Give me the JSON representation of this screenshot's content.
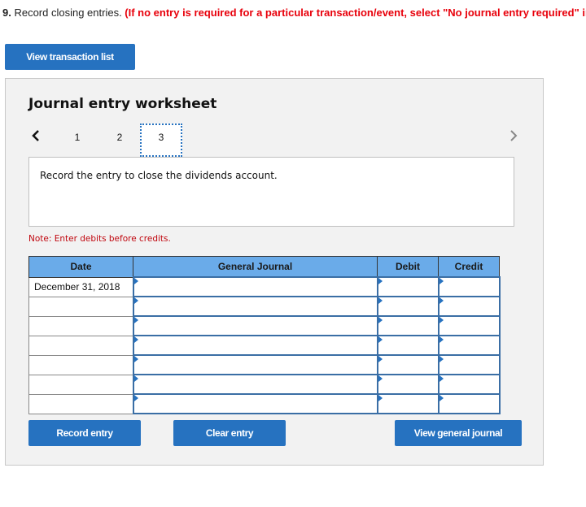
{
  "question": {
    "number": "9.",
    "text": " Record closing entries. ",
    "instruction": "(If no entry is required for a particular transaction/event, select \"No journal entry required\" in the first account field.)"
  },
  "buttons": {
    "view_transaction_list": "View transaction list",
    "record_entry": "Record entry",
    "clear_entry": "Clear entry",
    "view_general_journal": "View general journal"
  },
  "worksheet": {
    "title": "Journal entry worksheet",
    "pages": [
      "1",
      "2",
      "3"
    ],
    "current_page": "3",
    "description": "Record the entry to close the dividends account.",
    "note": "Note: Enter debits before credits."
  },
  "table": {
    "headers": {
      "date": "Date",
      "account": "General Journal",
      "debit": "Debit",
      "credit": "Credit"
    },
    "rows": [
      {
        "date": "December 31, 2018",
        "account": "",
        "debit": "",
        "credit": ""
      },
      {
        "date": "",
        "account": "",
        "debit": "",
        "credit": ""
      },
      {
        "date": "",
        "account": "",
        "debit": "",
        "credit": ""
      },
      {
        "date": "",
        "account": "",
        "debit": "",
        "credit": ""
      },
      {
        "date": "",
        "account": "",
        "debit": "",
        "credit": ""
      },
      {
        "date": "",
        "account": "",
        "debit": "",
        "credit": ""
      },
      {
        "date": "",
        "account": "",
        "debit": "",
        "credit": ""
      }
    ]
  },
  "colors": {
    "button_blue": "#2672c0",
    "header_blue": "#6aabe9",
    "instruction_red": "#e8000b",
    "note_red": "#c0060e"
  }
}
